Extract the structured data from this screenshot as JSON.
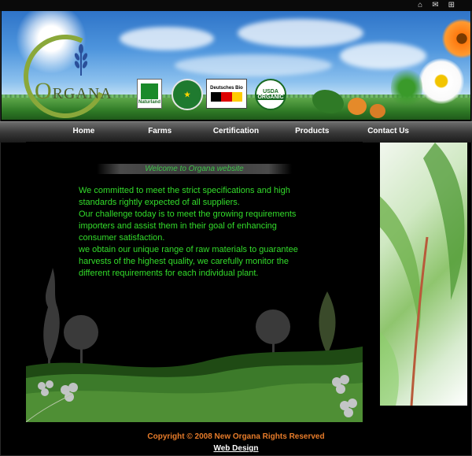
{
  "top_icons": [
    {
      "name": "home-icon",
      "glyph": "⌂"
    },
    {
      "name": "mail-icon",
      "glyph": "✉"
    },
    {
      "name": "sitemap-icon",
      "glyph": "⊞"
    }
  ],
  "logo": {
    "first_letter": "O",
    "rest": "RGANA"
  },
  "badges": {
    "naturland": "Naturland",
    "eu": "★",
    "german": "Deutsches Bio",
    "usda_top": "USDA",
    "usda_bottom": "ORGANIC"
  },
  "nav": {
    "items": [
      "Home",
      "Farms",
      "Certification",
      "Products",
      "Contact Us"
    ]
  },
  "main": {
    "welcome": "Welcome to Organa website",
    "paragraphs": [
      "We committed to meet the strict specifications and high standards rightly expected of all suppliers.",
      "Our challenge today is to meet the growing requirements importers and assist them in their goal of enhancing consumer satisfaction.",
      "we obtain our unique range of raw materials to guarantee harvests of the highest quality, we carefully monitor the different requirements for each individual plant."
    ]
  },
  "footer": {
    "copyright": "Copyright © 2008 New Organa Rights Reserved",
    "web_design": "Web Design"
  },
  "colors": {
    "body_text": "#33dd2b",
    "welcome": "#3fc44a",
    "copyright": "#e87c2a",
    "background": "#000000"
  }
}
